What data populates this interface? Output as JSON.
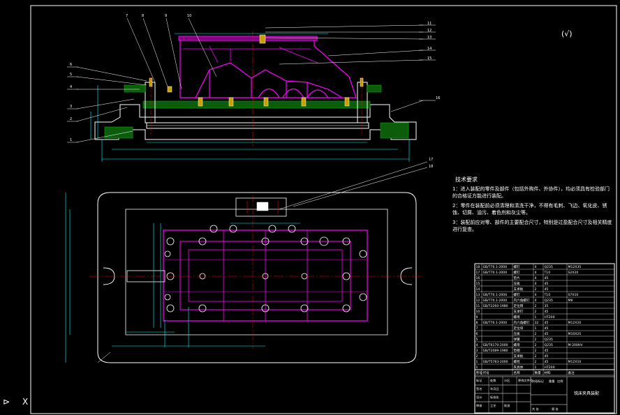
{
  "colors": {
    "background": "#000000",
    "frame": "#ffffff",
    "outline": "#ffffff",
    "part": "#ff00ff",
    "dimension": "#00ffff",
    "centerline": "#ff0000",
    "hatch": "#00aa00",
    "text": "#ffffff",
    "gold": "#c8a000"
  },
  "roughness_symbol": "(√)",
  "balloons_top": [
    "7",
    "8",
    "9",
    "10",
    "11",
    "12",
    "13",
    "14",
    "15",
    "16",
    "17",
    "18",
    "6",
    "5",
    "4",
    "3",
    "2",
    "1"
  ],
  "balloons_plan": [
    "17",
    "18"
  ],
  "tech_requirements": {
    "title": "技术要求",
    "items": [
      "1：进入装配的零件及部件（包括外购件、外协件），均必须具有检验部门的合格证方能进行装配。",
      "2：零件在装配前必须清理和清洗干净，不得有毛刺、飞边、氧化皮、锈蚀、切屑、油污、着色剂和灰尘等。",
      "3：装配前应对零、部件的主要配合尺寸，特别是过盈配合尺寸及相关精度进行复查。"
    ]
  },
  "parts_list": [
    {
      "no": "18",
      "code": "GB/T70.1-2000",
      "name": "螺钉",
      "qty": "4",
      "mat": "Q235",
      "note": "M12X35"
    },
    {
      "no": "17",
      "code": "GB/T70.1-2000",
      "name": "螺钉",
      "qty": "4",
      "mat": "T10",
      "note": "S2X20"
    },
    {
      "no": "16",
      "code": "",
      "name": "垫片",
      "qty": "4",
      "mat": "45",
      "note": ""
    },
    {
      "no": "15",
      "code": "",
      "name": "压板",
      "qty": "4",
      "mat": "45",
      "note": ""
    },
    {
      "no": "14",
      "code": "",
      "name": "支承板",
      "qty": "2",
      "mat": "45",
      "note": ""
    },
    {
      "no": "13",
      "code": "GB/T70.1-2000",
      "name": "螺钉",
      "qty": "4",
      "mat": "T10",
      "note": "S7X10"
    },
    {
      "no": "12",
      "code": "GB/T70.1-2000",
      "name": "内六角螺钉",
      "qty": "4",
      "mat": "Q235",
      "note": "M8"
    },
    {
      "no": "11",
      "code": "GB/T2260-1980",
      "name": "定位销",
      "qty": "2",
      "mat": "35",
      "note": ""
    },
    {
      "no": "10",
      "code": "",
      "name": "支承钉",
      "qty": "2",
      "mat": "45",
      "note": ""
    },
    {
      "no": "9",
      "code": "",
      "name": "螺母",
      "qty": "1",
      "mat": "HT200",
      "note": ""
    },
    {
      "no": "8",
      "code": "GB/T70.1-2000",
      "name": "内六角螺钉",
      "qty": "32",
      "mat": "45",
      "note": "M12X20"
    },
    {
      "no": "7",
      "code": "",
      "name": "定位块",
      "qty": "1",
      "mat": "45",
      "note": ""
    },
    {
      "no": "6",
      "code": "",
      "name": "压板",
      "qty": "2",
      "mat": "45",
      "note": "M10X25"
    },
    {
      "no": "5",
      "code": "",
      "name": "弹簧",
      "qty": "2",
      "mat": "Q235",
      "note": ""
    },
    {
      "no": "4",
      "code": "GB/T6170-2000",
      "name": "螺母",
      "qty": "2",
      "mat": "Q235",
      "note": "M-200HV"
    },
    {
      "no": "3",
      "code": "GB/T2089-1980",
      "name": "垫圈",
      "qty": "2",
      "mat": "45",
      "note": ""
    },
    {
      "no": "2",
      "code": "",
      "name": "支承板",
      "qty": "2",
      "mat": "45",
      "note": ""
    },
    {
      "no": "1",
      "code": "GB/T5783-2000",
      "name": "螺栓",
      "qty": "2",
      "mat": "45",
      "note": "M12X10"
    },
    {
      "no": "1",
      "code": "",
      "name": "夹具体",
      "qty": "1",
      "mat": "HT200",
      "note": ""
    }
  ],
  "parts_header": {
    "no": "序号",
    "code": "代号",
    "name": "名称",
    "qty": "数量",
    "mat": "材料",
    "note": "备注"
  },
  "title_block": {
    "drawing_name": "铣床夹具装配",
    "labels": [
      "标记",
      "处数",
      "分区",
      "更改文件号",
      "签名",
      "年月日",
      "设计",
      "标准化",
      "审核",
      "工艺",
      "批准",
      "阶段标记",
      "重量",
      "比例",
      "共 张",
      "第 张"
    ]
  },
  "corner_marks": [
    "⊳",
    "X"
  ]
}
